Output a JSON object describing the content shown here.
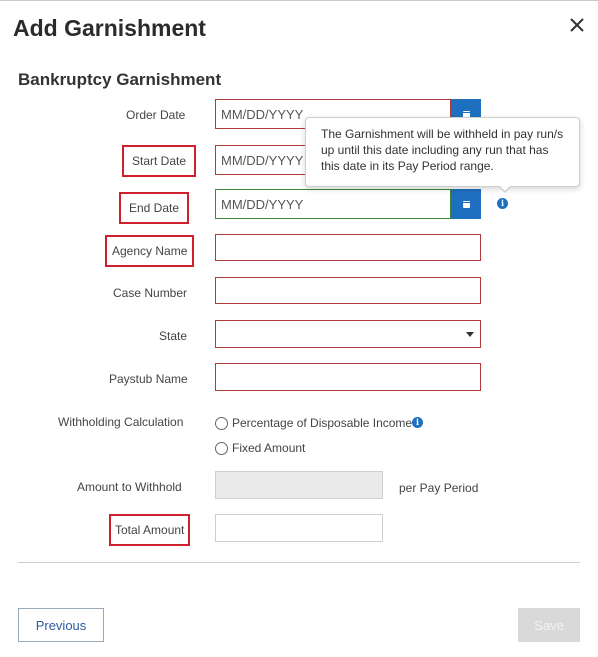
{
  "dialog": {
    "title": "Add Garnishment",
    "section_title": "Bankruptcy Garnishment"
  },
  "fields": {
    "order_date": {
      "label": "Order Date",
      "placeholder": "MM/DD/YYYY"
    },
    "start_date": {
      "label": "Start Date",
      "placeholder": "MM/DD/YYYY"
    },
    "end_date": {
      "label": "End Date",
      "placeholder": "MM/DD/YYYY"
    },
    "agency_name": {
      "label": "Agency Name",
      "value": ""
    },
    "case_number": {
      "label": "Case Number",
      "value": ""
    },
    "state": {
      "label": "State",
      "value": ""
    },
    "paystub_name": {
      "label": "Paystub Name",
      "value": ""
    },
    "withholding": {
      "label": "Withholding Calculation",
      "options": [
        "Percentage of Disposable Income",
        "Fixed Amount"
      ]
    },
    "amount_to_withhold": {
      "label": "Amount to Withhold",
      "suffix": "per Pay Period",
      "value": ""
    },
    "total_amount": {
      "label": "Total Amount",
      "value": ""
    }
  },
  "tooltip": {
    "text": "The Garnishment will be withheld in pay run/s up until this date including any run that has this date in its Pay Period range."
  },
  "buttons": {
    "previous": "Previous",
    "save": "Save"
  },
  "icons": {
    "close": "close-icon",
    "calendar": "calendar-icon",
    "info": "info-icon",
    "dropdown": "chevron-down-icon"
  },
  "colors": {
    "accent": "#1f6fc0",
    "error_border": "#b03a3a",
    "highlight_box": "#d0202e",
    "valid_border": "#3a8a3a"
  }
}
